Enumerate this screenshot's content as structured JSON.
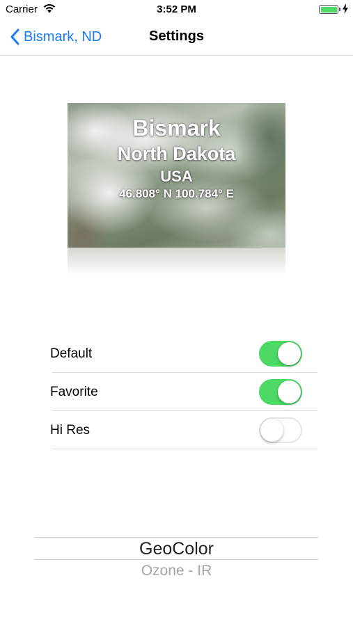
{
  "status_bar": {
    "carrier": "Carrier",
    "time": "3:52 PM",
    "battery_color": "#4cd964"
  },
  "nav": {
    "back_label": "Bismark, ND",
    "title": "Settings",
    "accent": "#1a7cf5"
  },
  "image_card": {
    "city": "Bismark",
    "state": "North Dakota",
    "country": "USA",
    "coordinates": "46.808° N 100.784° E"
  },
  "settings": [
    {
      "label": "Default",
      "on": true
    },
    {
      "label": "Favorite",
      "on": true
    },
    {
      "label": "Hi Res",
      "on": false
    }
  ],
  "picker": {
    "selected": "GeoColor",
    "next": "Ozone - IR"
  },
  "colors": {
    "toggle_on": "#4cd964",
    "toggle_off_border": "#e5e5ea"
  }
}
